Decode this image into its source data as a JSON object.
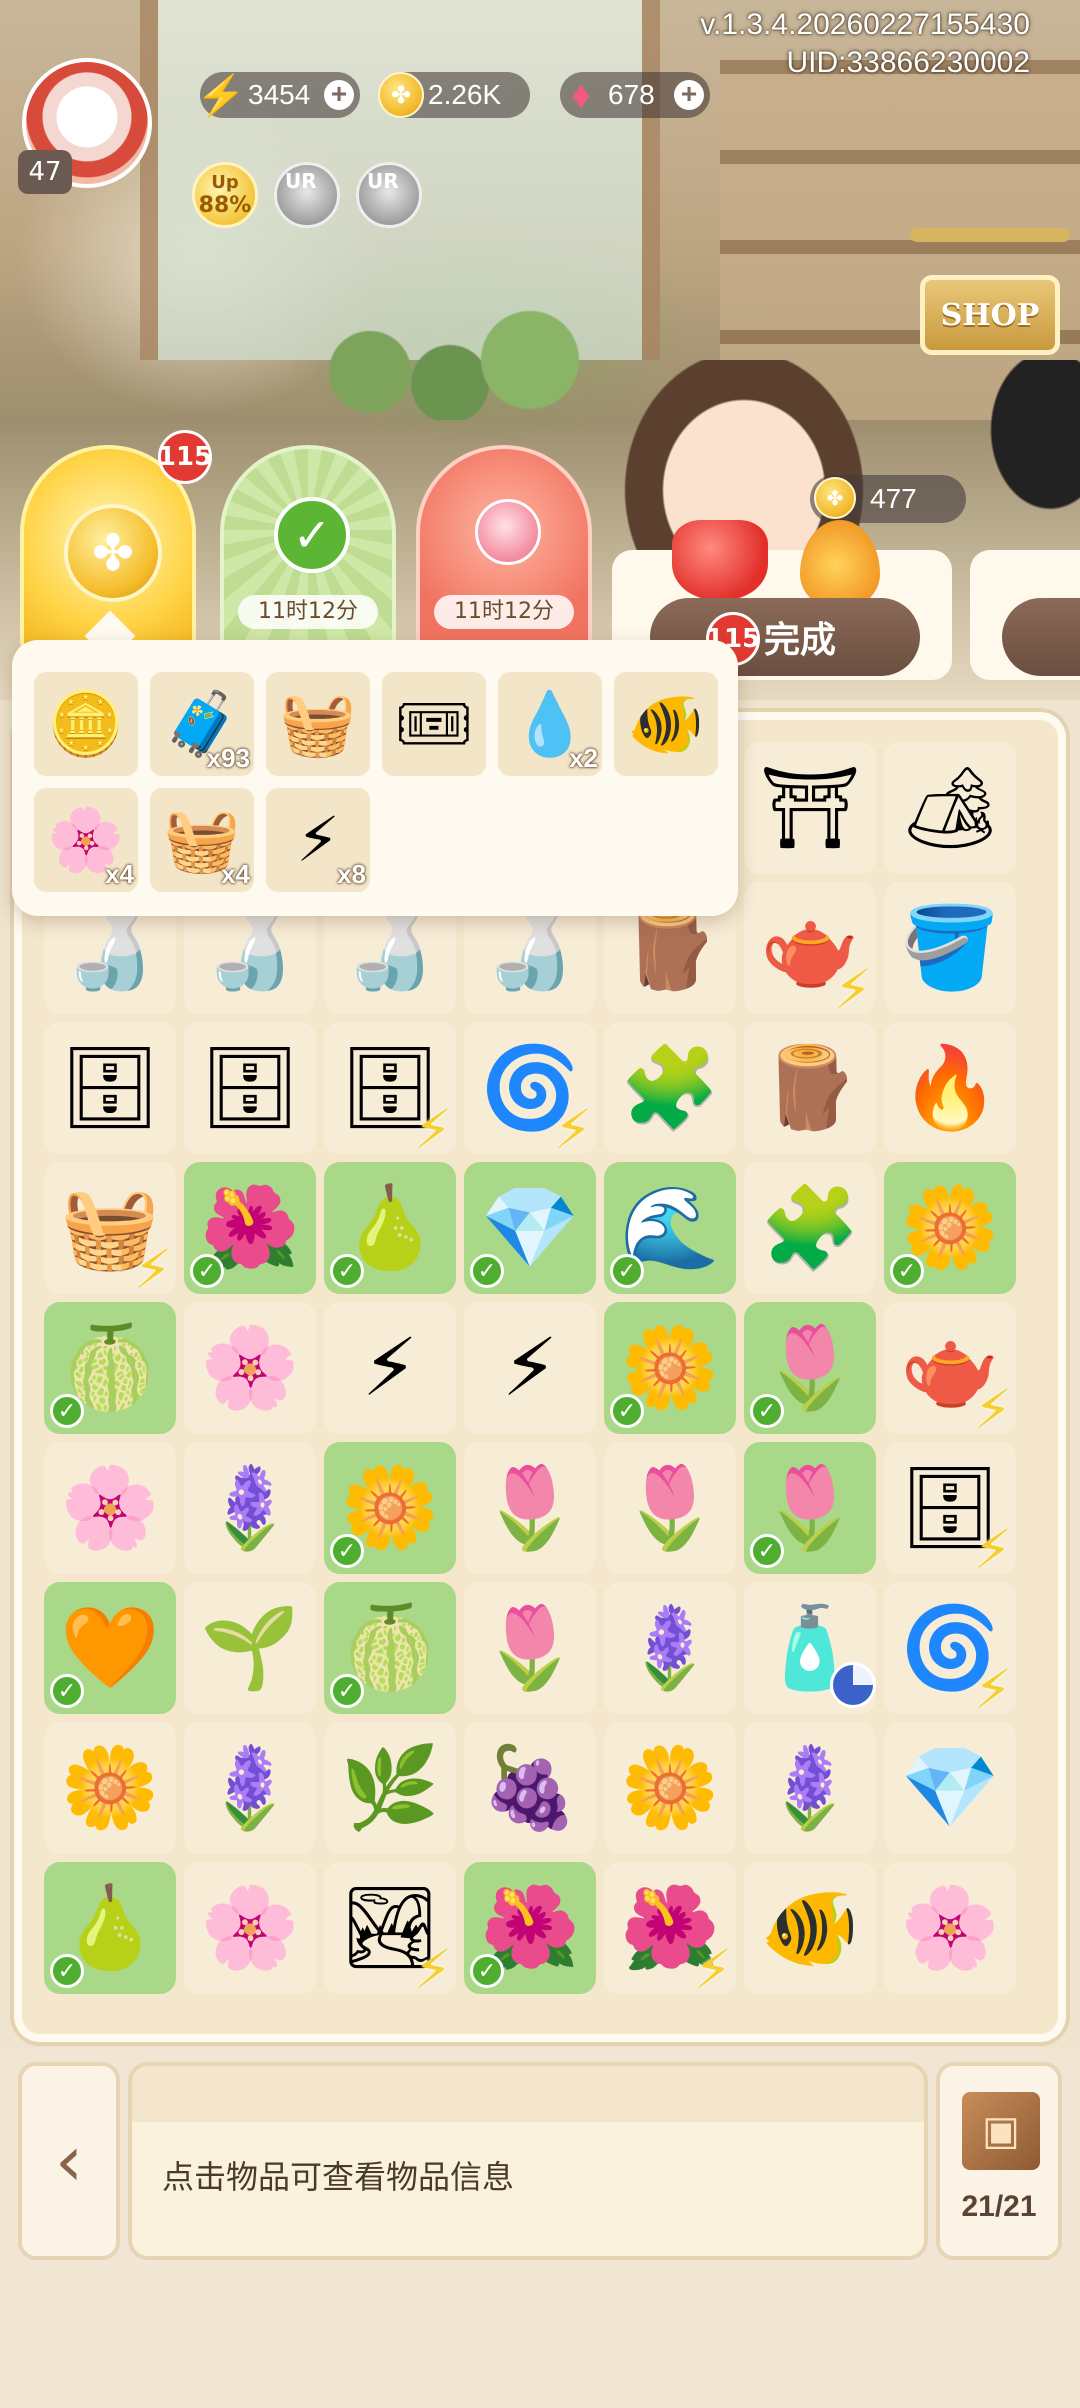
{
  "hud": {
    "version": "v.1.3.4.20260227155430",
    "uid": "UID:33866230002",
    "level": "47",
    "energy": "3454",
    "coins": "2.26K",
    "gems": "678",
    "up_label": "Up",
    "up_percent": "88%",
    "ur_label": "UR"
  },
  "shop": {
    "label": "SHOP"
  },
  "orders": {
    "red_badge": "115",
    "timer_1": "11时12分",
    "timer_2": "11时12分",
    "order_coins": "477",
    "complete_badge": "115",
    "complete_label": "完成"
  },
  "popup_items": [
    {
      "icon": "🪙",
      "qty": ""
    },
    {
      "icon": "🧳",
      "qty": "x93"
    },
    {
      "icon": "🧺",
      "qty": ""
    },
    {
      "icon": "🎟",
      "qty": ""
    },
    {
      "icon": "💧",
      "qty": "x2"
    },
    {
      "icon": "🐠",
      "qty": ""
    },
    {
      "icon": "🌸",
      "qty": "x4"
    },
    {
      "icon": "🧺",
      "qty": "x4"
    },
    {
      "icon": "⚡",
      "qty": "x8"
    }
  ],
  "board": [
    [
      {
        "icon": "",
        "bg": "lt"
      },
      {
        "icon": "",
        "bg": "lt"
      },
      {
        "icon": "",
        "bg": "lt"
      },
      {
        "icon": "",
        "bg": "lt"
      },
      {
        "icon": "",
        "bg": "lt"
      },
      {
        "icon": "⛩",
        "bg": "lt"
      },
      {
        "icon": "🏕",
        "bg": "lt"
      }
    ],
    [
      {
        "icon": "🍶",
        "bg": "lt"
      },
      {
        "icon": "🍶",
        "bg": "lt"
      },
      {
        "icon": "🍶",
        "bg": "lt"
      },
      {
        "icon": "🍶",
        "bg": "lt"
      },
      {
        "icon": "🪵",
        "bg": "lt"
      },
      {
        "icon": "🫖",
        "bg": "lt",
        "bolt": true
      },
      {
        "icon": "🪣",
        "bg": "lt"
      }
    ],
    [
      {
        "icon": "🗄",
        "bg": "lt"
      },
      {
        "icon": "🗄",
        "bg": "lt"
      },
      {
        "icon": "🗄",
        "bg": "lt",
        "bolt": true
      },
      {
        "icon": "🌀",
        "bg": "lt",
        "bolt": true
      },
      {
        "icon": "🧩",
        "bg": "lt"
      },
      {
        "icon": "🪵",
        "bg": "lt"
      },
      {
        "icon": "🔥",
        "bg": "lt"
      }
    ],
    [
      {
        "icon": "🧺",
        "bg": "lt",
        "bolt": true
      },
      {
        "icon": "🌺",
        "bg": "gr",
        "check": true
      },
      {
        "icon": "🍐",
        "bg": "gr",
        "check": true
      },
      {
        "icon": "💎",
        "bg": "gr",
        "check": true
      },
      {
        "icon": "🌊",
        "bg": "gr",
        "check": true
      },
      {
        "icon": "🧩",
        "bg": "lt"
      },
      {
        "icon": "🌼",
        "bg": "gr",
        "check": true
      }
    ],
    [
      {
        "icon": "🍈",
        "bg": "gr",
        "check": true
      },
      {
        "icon": "🌸",
        "bg": "lt"
      },
      {
        "icon": "⚡",
        "bg": "lt"
      },
      {
        "icon": "⚡",
        "bg": "lt"
      },
      {
        "icon": "🌼",
        "bg": "gr",
        "check": true
      },
      {
        "icon": "🌷",
        "bg": "gr",
        "check": true
      },
      {
        "icon": "🫖",
        "bg": "lt",
        "bolt": true
      }
    ],
    [
      {
        "icon": "🌸",
        "bg": "lt"
      },
      {
        "icon": "🪻",
        "bg": "lt"
      },
      {
        "icon": "🌼",
        "bg": "gr",
        "check": true
      },
      {
        "icon": "🌷",
        "bg": "lt"
      },
      {
        "icon": "🌷",
        "bg": "lt"
      },
      {
        "icon": "🌷",
        "bg": "gr",
        "check": true
      },
      {
        "icon": "🗄",
        "bg": "lt",
        "bolt": true
      }
    ],
    [
      {
        "icon": "🧡",
        "bg": "gr",
        "check": true
      },
      {
        "icon": "🌱",
        "bg": "lt"
      },
      {
        "icon": "🍈",
        "bg": "gr",
        "check": true
      },
      {
        "icon": "🌷",
        "bg": "lt"
      },
      {
        "icon": "🪻",
        "bg": "lt"
      },
      {
        "icon": "🧴",
        "bg": "lt",
        "timer": true
      },
      {
        "icon": "🌀",
        "bg": "lt",
        "bolt": true
      }
    ],
    [
      {
        "icon": "🌼",
        "bg": "lt"
      },
      {
        "icon": "🪻",
        "bg": "lt"
      },
      {
        "icon": "🌿",
        "bg": "lt"
      },
      {
        "icon": "🍇",
        "bg": "lt"
      },
      {
        "icon": "🌼",
        "bg": "lt"
      },
      {
        "icon": "🪻",
        "bg": "lt"
      },
      {
        "icon": "💎",
        "bg": "lt"
      }
    ],
    [
      {
        "icon": "🍐",
        "bg": "gr",
        "check": true
      },
      {
        "icon": "🌸",
        "bg": "lt"
      },
      {
        "icon": "🏞",
        "bg": "lt",
        "bolt": true
      },
      {
        "icon": "🌺",
        "bg": "gr",
        "check": true
      },
      {
        "icon": "🌺",
        "bg": "lt",
        "bolt": true
      },
      {
        "icon": "🐠",
        "bg": "lt"
      },
      {
        "icon": "🌸",
        "bg": "lt"
      }
    ]
  ],
  "bottom": {
    "info_text": "点击物品可查看物品信息",
    "inventory_count": "21/21"
  }
}
